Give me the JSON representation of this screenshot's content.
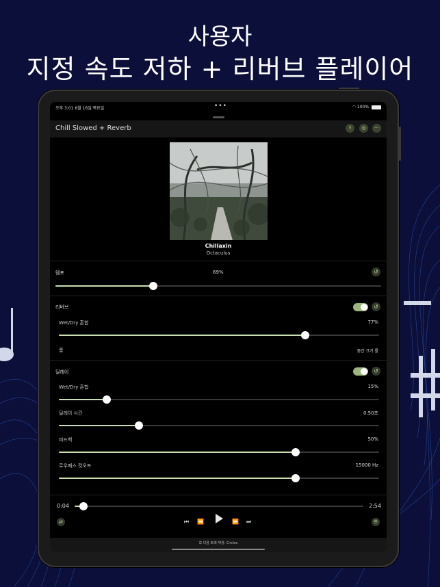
{
  "headline": {
    "line1": "사용자",
    "line2": "지정 속도 저하 + 리버브 플레이어"
  },
  "status_bar": {
    "time": "오후 3:01  6월 16일 목요일",
    "dots": "•••",
    "right": "100%"
  },
  "header": {
    "title": "Chill Slowed + Reverb",
    "buttons": [
      "share-icon",
      "settings-icon",
      "more-icon"
    ]
  },
  "track": {
    "title": "Chillaxin",
    "artist": "Octaculus"
  },
  "tempo": {
    "label": "템포",
    "value": "69%",
    "level": 0.3
  },
  "reverb": {
    "label": "리버브",
    "enabled": true,
    "wetdry_label": "Wet/Dry 혼합",
    "wetdry_value": "77%",
    "wetdry_level": 0.77,
    "room_label": "룸",
    "room_value": "중간 크기 룸"
  },
  "delay": {
    "label": "딜레이",
    "enabled": true,
    "wetdry_label": "Wet/Dry 혼합",
    "wetdry_value": "15%",
    "wetdry_level": 0.15,
    "time_label": "딜레이 시간",
    "time_value": "0.50초",
    "time_level": 0.25,
    "feedback_label": "피드백",
    "feedback_value": "50%",
    "feedback_level": 0.74,
    "lowpass_label": "로우패스 컷오프",
    "lowpass_value": "15000 Hz",
    "lowpass_level": 0.74
  },
  "player": {
    "elapsed": "0:04",
    "duration": "2:54",
    "progress": 0.03
  },
  "bottom_bar": {
    "next_track": "다음 트랙 재생: Circles"
  },
  "colors": {
    "background": "#0b0f3a",
    "accent": "#c8e0b4",
    "toggle_on": "#9bb57c"
  }
}
